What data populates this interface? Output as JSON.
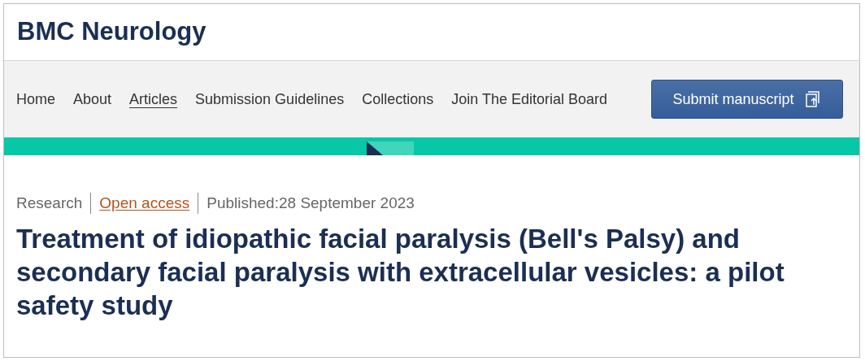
{
  "journal": {
    "title": "BMC Neurology"
  },
  "nav": {
    "items": [
      {
        "label": "Home",
        "selected": false
      },
      {
        "label": "About",
        "selected": false
      },
      {
        "label": "Articles",
        "selected": true
      },
      {
        "label": "Submission Guidelines",
        "selected": false
      },
      {
        "label": "Collections",
        "selected": false
      },
      {
        "label": "Join The Editorial Board",
        "selected": false
      }
    ],
    "submit_button": "Submit manuscript"
  },
  "article": {
    "meta": [
      {
        "kind": "type",
        "text": "Research"
      },
      {
        "kind": "link",
        "text": "Open access"
      },
      {
        "kind": "date",
        "text": "Published:28 September 2023"
      }
    ],
    "title": "Treatment of idiopathic facial paralysis (Bell's Palsy) and secondary facial paralysis with extracellular vesicles: a pilot safety study"
  }
}
